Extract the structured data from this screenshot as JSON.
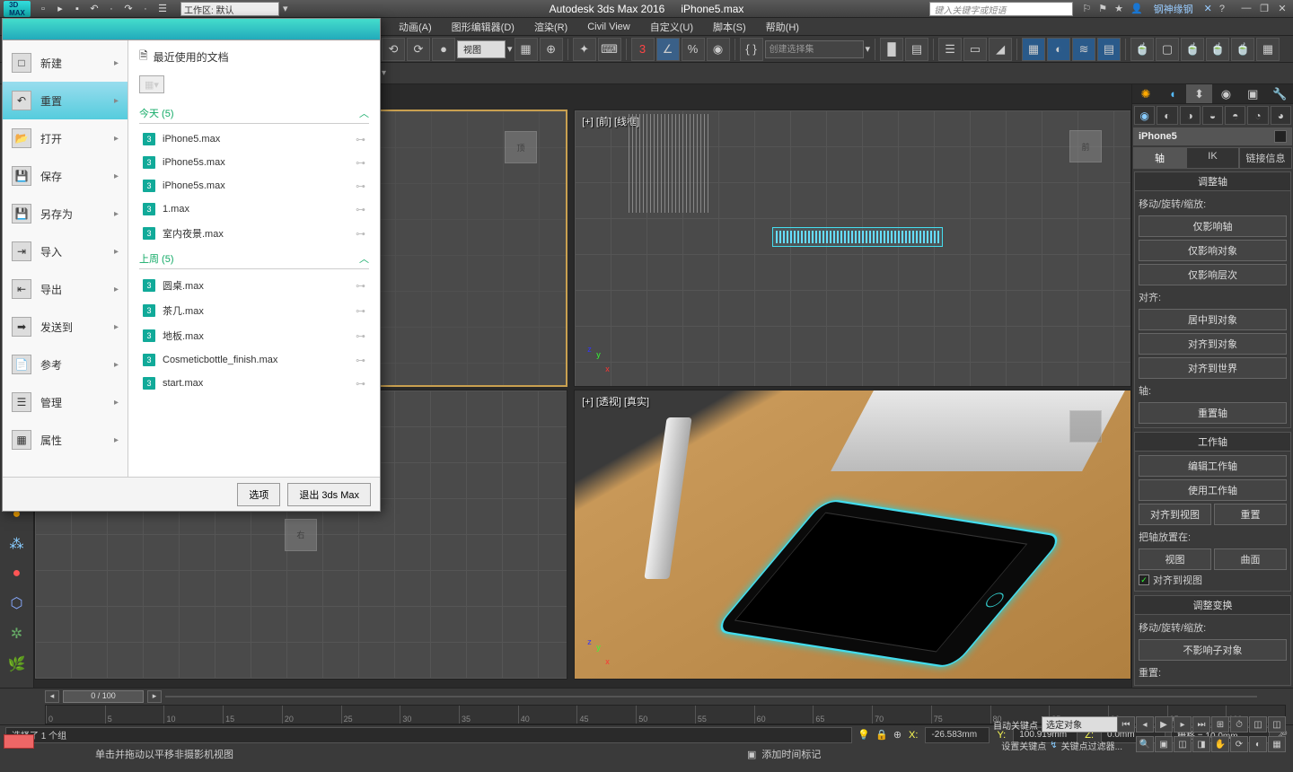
{
  "titlebar": {
    "workspace_label": "工作区: 默认",
    "app_title": "Autodesk 3ds Max 2016",
    "file_title": "iPhone5.max",
    "search_placeholder": "键入关键字或短语",
    "user": "钢神缘钢"
  },
  "menubar": [
    "动画(A)",
    "图形编辑器(D)",
    "渲染(R)",
    "Civil View",
    "自定义(U)",
    "脚本(S)",
    "帮助(H)"
  ],
  "toolbar": {
    "view_select": "视图",
    "named_sel_placeholder": "创建选择集"
  },
  "appmenu": {
    "left_items": [
      {
        "label": "新建",
        "icon": "□"
      },
      {
        "label": "重置",
        "icon": "↶",
        "selected": true
      },
      {
        "label": "打开",
        "icon": "📂"
      },
      {
        "label": "保存",
        "icon": "💾"
      },
      {
        "label": "另存为",
        "icon": "💾"
      },
      {
        "label": "导入",
        "icon": "⇥"
      },
      {
        "label": "导出",
        "icon": "⇤"
      },
      {
        "label": "发送到",
        "icon": "➡"
      },
      {
        "label": "参考",
        "icon": "📄"
      },
      {
        "label": "管理",
        "icon": "☰"
      },
      {
        "label": "属性",
        "icon": "▦"
      }
    ],
    "recent_title": "最近使用的文档",
    "groups": [
      {
        "title": "今天 (5)",
        "files": [
          "iPhone5.max",
          "iPhone5s.max",
          "iPhone5s.max",
          "1.max",
          "室内夜景.max"
        ]
      },
      {
        "title": "上周 (5)",
        "files": [
          "圆桌.max",
          "茶几.max",
          "地板.max",
          "Cosmeticbottle_finish.max",
          "start.max"
        ]
      }
    ],
    "btn_options": "选项",
    "btn_exit": "退出 3ds Max"
  },
  "viewports": {
    "tl_label": "",
    "tr_label": "[+] [前] [线框]",
    "bl_label": "",
    "br_label": "[+] [透视] [真实]",
    "cube_right": "右",
    "cube_top": "顶",
    "cube_front": "前"
  },
  "right_panel": {
    "object": "iPhone5",
    "tab_axis": "轴",
    "tab_ik": "IK",
    "tab_link": "链接信息",
    "sec_adjust_axis": "调整轴",
    "lbl_mrs": "移动/旋转/缩放:",
    "btn_affect_pivot": "仅影响轴",
    "btn_affect_obj": "仅影响对象",
    "btn_affect_hier": "仅影响层次",
    "lbl_align": "对齐:",
    "btn_center": "居中到对象",
    "btn_alignobj": "对齐到对象",
    "btn_alignworld": "对齐到世界",
    "lbl_axis": "轴:",
    "btn_resetaxis": "重置轴",
    "sec_work_axis": "工作轴",
    "btn_editwa": "编辑工作轴",
    "btn_usewa": "使用工作轴",
    "btn_alignview": "对齐到视图",
    "btn_reset": "重置",
    "lbl_placeaxis": "把轴放置在:",
    "btn_view": "视图",
    "btn_surf": "曲面",
    "chk_alignview": "对齐到视图",
    "sec_adjust_xform": "调整变换",
    "lbl_mrs2": "移动/旋转/缩放:",
    "btn_noaffectchild": "不影响子对象",
    "lbl_reset2": "重置:"
  },
  "timeline": {
    "slider_label": "0 / 100",
    "ticks": [
      "0",
      "5",
      "10",
      "15",
      "20",
      "25",
      "30",
      "35",
      "40",
      "45",
      "50",
      "55",
      "60",
      "65",
      "70",
      "75",
      "80",
      "85",
      "90",
      "95",
      "100"
    ]
  },
  "status": {
    "msg1": "选择了 1 个组",
    "msg2": "单击并拖动以平移非摄影机视图",
    "x": "-26.583mm",
    "y": "100.919mm",
    "z": "0.0mm",
    "grid": "栅格 = 10.0mm",
    "addtime": "添加时间标记",
    "autokey": "自动关键点",
    "selobj": "选定对象",
    "setkey": "设置关键点",
    "filter": "关键点过滤器..."
  }
}
